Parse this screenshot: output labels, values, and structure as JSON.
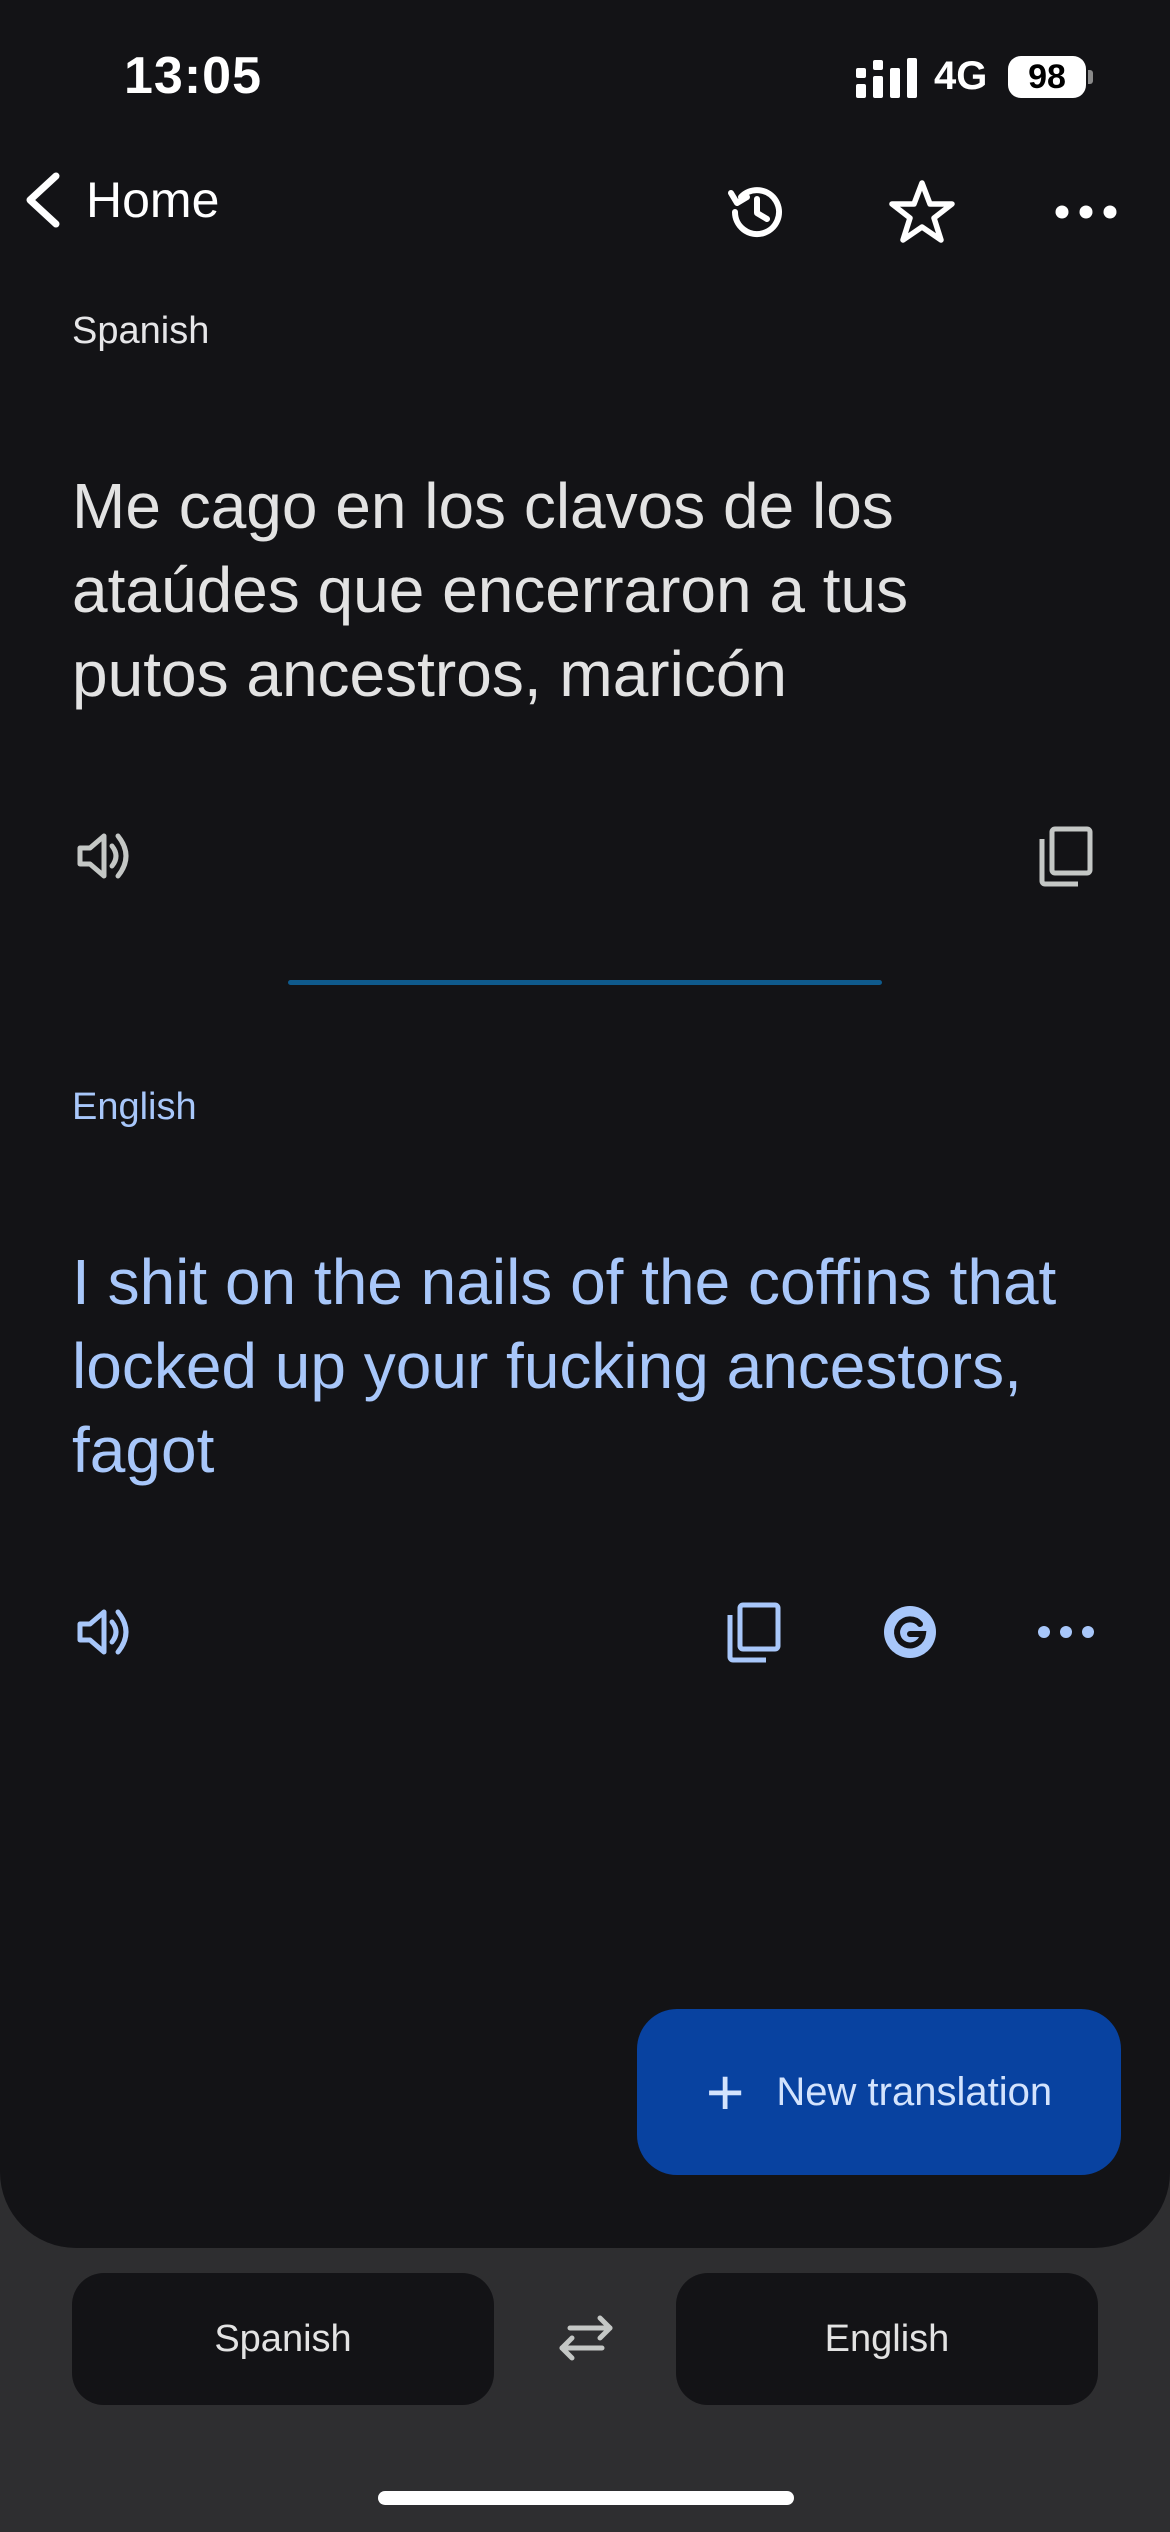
{
  "status_bar": {
    "time": "13:05",
    "network": "4G",
    "battery": "98"
  },
  "nav": {
    "back_label": "Home"
  },
  "source": {
    "language": "Spanish",
    "text": "Me cago en los clavos de los ataúdes que encerraron a tus putos ancestros, maricón"
  },
  "target": {
    "language": "English",
    "text": "I shit on the nails of the coffins that locked up your fucking ancestors, fagot"
  },
  "fab": {
    "label": "New translation"
  },
  "language_bar": {
    "source_label": "Spanish",
    "target_label": "English"
  },
  "colors": {
    "background": "#131316",
    "accent_text": "#a8c7fa",
    "fab": "#0842a0",
    "divider": "#0f5a8c"
  },
  "icons": [
    "chevron-left-icon",
    "history-icon",
    "star-icon",
    "more-icon",
    "speaker-icon",
    "copy-icon",
    "google-icon",
    "swap-icon"
  ]
}
